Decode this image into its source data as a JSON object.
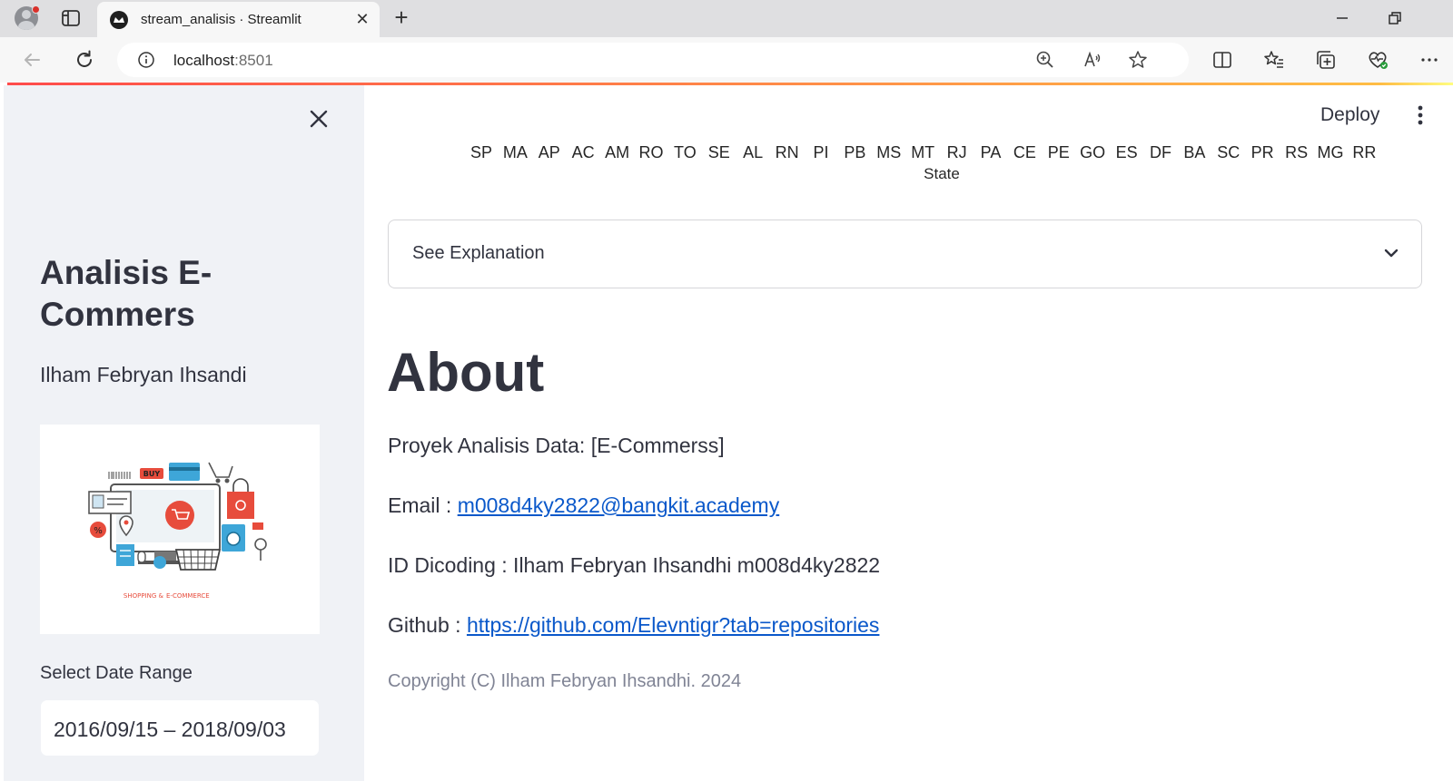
{
  "browser": {
    "tab_title": "stream_analisis · Streamlit",
    "url_host": "localhost",
    "url_port": ":8501"
  },
  "header": {
    "deploy_label": "Deploy"
  },
  "sidebar": {
    "title": "Analisis E-Commers",
    "author": "Ilham Febryan Ihsandi",
    "image_caption_left": "SHOPPING &",
    "image_caption_right": "E-COMMERCE",
    "image_badge": "BUY",
    "date_label": "Select Date Range",
    "date_value": "2016/09/15 – 2018/09/03"
  },
  "chart_data": {
    "type": "bar",
    "categories": [
      "SP",
      "MA",
      "AP",
      "AC",
      "AM",
      "RO",
      "TO",
      "SE",
      "AL",
      "RN",
      "PI",
      "PB",
      "MS",
      "MT",
      "RJ",
      "PA",
      "CE",
      "PE",
      "GO",
      "ES",
      "DF",
      "BA",
      "SC",
      "PR",
      "RS",
      "MG",
      "RR"
    ],
    "xlabel": "State"
  },
  "main": {
    "expander_label": "See Explanation",
    "about_heading": "About",
    "project_line": "Proyek Analisis Data: [E-Commerss]",
    "email_label": "Email : ",
    "email_value": "m008d4ky2822@bangkit.academy",
    "dicoding_line": "ID Dicoding : Ilham Febryan Ihsandhi m008d4ky2822",
    "github_label": "Github : ",
    "github_value": "https://github.com/Elevntigr?tab=repositories",
    "copyright": "Copyright (C) Ilham Febryan Ihsandhi. 2024"
  },
  "colors": {
    "accent_red": "#ff4b4b",
    "sidebar_bg": "#f0f2f6",
    "link_blue": "#0a58ca"
  }
}
